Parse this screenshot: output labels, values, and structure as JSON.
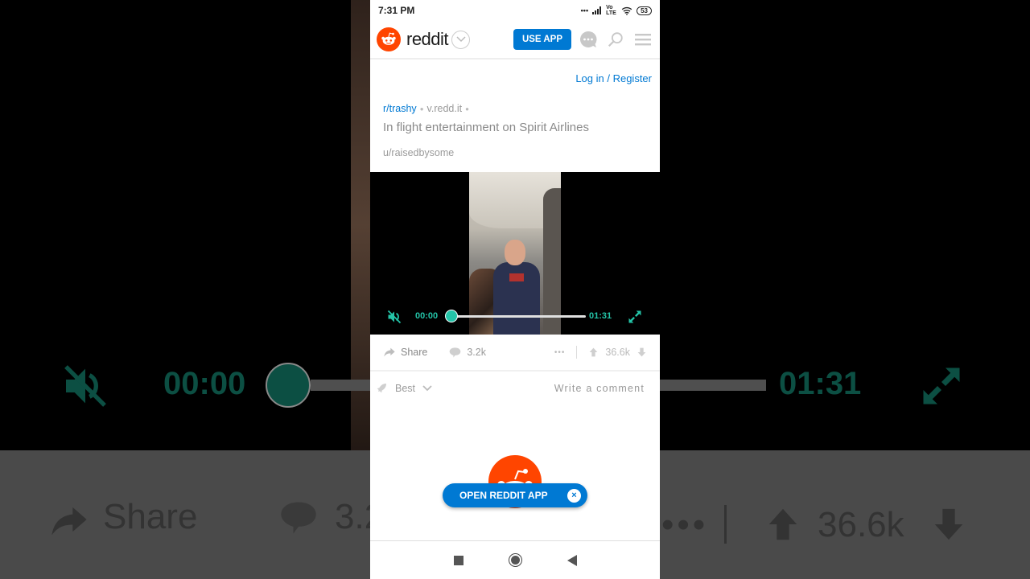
{
  "status_bar": {
    "time": "7:31 PM",
    "network": "Vo LTE",
    "battery": "53"
  },
  "header": {
    "wordmark": "reddit",
    "use_app_label": "USE APP"
  },
  "auth": {
    "login_register": "Log in / Register"
  },
  "post": {
    "subreddit": "r/trashy",
    "domain": "v.redd.it",
    "title": "In flight entertainment on Spirit Airlines",
    "author": "u/raisedbysome"
  },
  "video": {
    "current_time": "00:00",
    "duration": "01:31",
    "progress": 0,
    "muted": true,
    "accent_color": "#24c4a8"
  },
  "actions": {
    "share_label": "Share",
    "comments_count": "3.2k",
    "more": "•••",
    "votes": "36.6k"
  },
  "comments": {
    "sort_label": "Best",
    "write_comment": "Write a comment"
  },
  "banner": {
    "open_app_label": "OPEN REDDIT APP",
    "close": "×"
  },
  "colors": {
    "brand": "#ff4500",
    "link": "#0079d3"
  }
}
